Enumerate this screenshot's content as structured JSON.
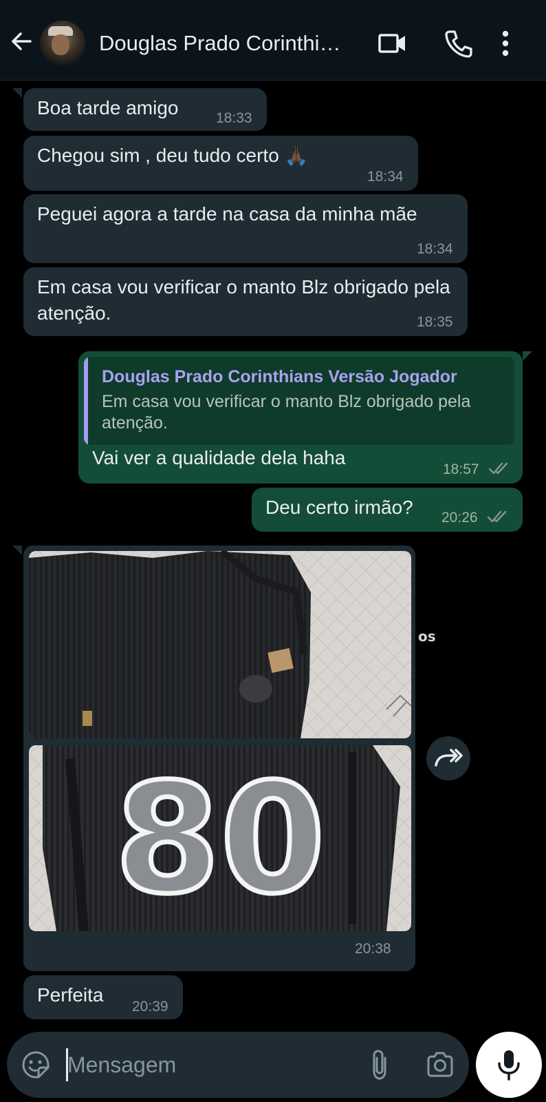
{
  "header": {
    "title": "Douglas Prado Corinthi…"
  },
  "messages": [
    {
      "text": "Boa tarde amigo",
      "time": "18:33"
    },
    {
      "text": "Chegou sim , deu tudo certo 🙏🏿",
      "time": "18:34"
    },
    {
      "text": "Peguei agora a tarde na casa da minha mãe",
      "time": "18:34"
    },
    {
      "text": "Em casa vou verificar o manto Blz obrigado pela atenção.",
      "time": "18:35"
    },
    {
      "quoted_author": "Douglas Prado Corinthians Versão Jogador",
      "quoted_text": "Em casa vou verificar o manto Blz obrigado pela atenção.",
      "text": "Vai ver a qualidade dela haha",
      "time": "18:57"
    },
    {
      "text": "Deu certo irmão?",
      "time": "20:26"
    },
    {
      "type": "image",
      "time": "20:38",
      "photo_number": "80"
    },
    {
      "text": "Perfeita",
      "time": "20:39"
    }
  ],
  "background_fragment": "os",
  "composer": {
    "placeholder": "Mensagem"
  },
  "colors": {
    "header_bg": "#0b141a",
    "incoming_bubble": "#1f2c34",
    "outgoing_bubble": "#144d37",
    "quote_accent": "#a59bf0",
    "read_ticks": "#8696a0"
  }
}
